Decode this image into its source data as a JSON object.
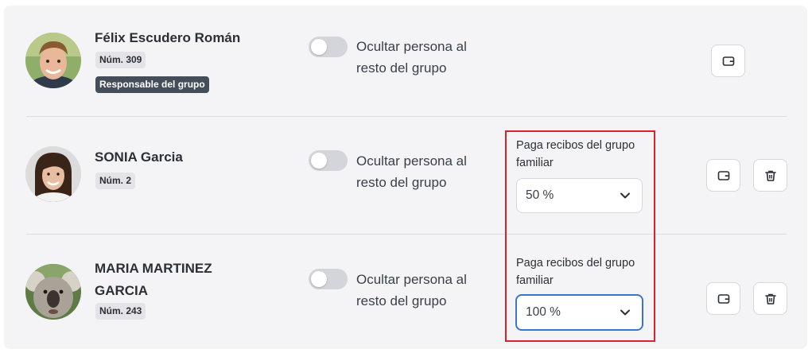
{
  "members": [
    {
      "name": "Félix Escudero Román",
      "number": "Núm. 309",
      "role_badge": "Responsable del grupo",
      "avatar_icon": "young-man-photo",
      "hide_toggle_label": "Ocultar persona al resto del grupo",
      "hide_toggle_on": false,
      "wallet_icon": "wallet-icon"
    },
    {
      "name": "SONIA Garcia",
      "number": "Núm. 2",
      "avatar_icon": "woman-photo",
      "hide_toggle_label": "Ocultar persona al resto del grupo",
      "hide_toggle_on": false,
      "pays_label": "Paga recibos del grupo familiar",
      "pays_value": "50 %",
      "wallet_icon": "wallet-icon",
      "delete_icon": "trash-icon"
    },
    {
      "name": "MARIA MARTINEZ GARCIA",
      "number": "Núm. 243",
      "avatar_icon": "koala-photo",
      "hide_toggle_label": "Ocultar persona al resto del grupo",
      "hide_toggle_on": false,
      "pays_label": "Paga recibos del grupo familiar",
      "pays_value": "100 %",
      "wallet_icon": "wallet-icon",
      "delete_icon": "trash-icon"
    }
  ],
  "colors": {
    "panel_bg": "#f4f4f7",
    "badge_dark": "#454d5b",
    "focus_border": "#3b73d1",
    "highlight_border": "#d8232a"
  }
}
